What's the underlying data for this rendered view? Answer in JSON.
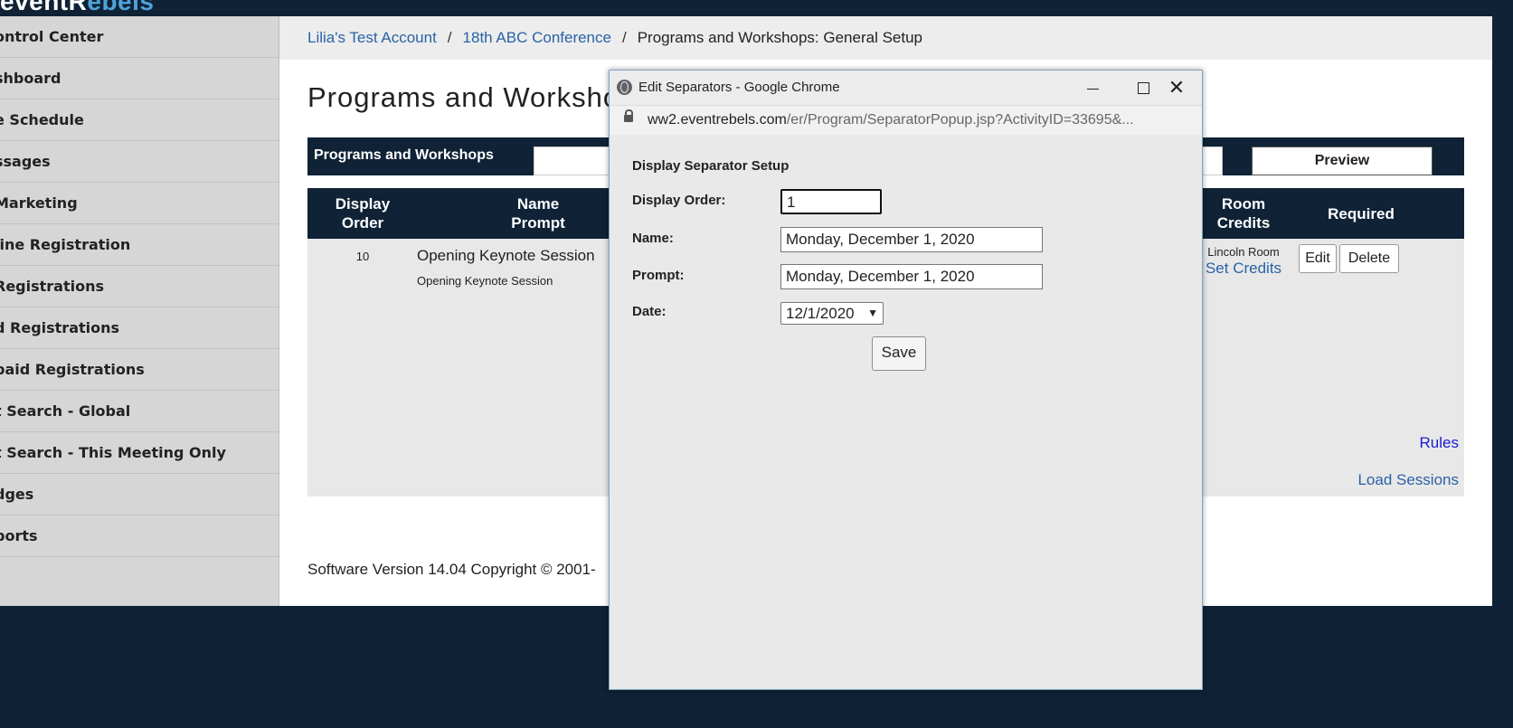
{
  "brand": {
    "logo_main": "eventR",
    "logo_accent": "ebels"
  },
  "sidebar": {
    "items": [
      {
        "label": "ontrol Center"
      },
      {
        "label": "shboard"
      },
      {
        "label": "e Schedule"
      },
      {
        "label": "ssages"
      },
      {
        "label": "Marketing"
      },
      {
        "label": "line Registration"
      },
      {
        "label": " Registrations"
      },
      {
        "label": "d Registrations"
      },
      {
        "label": "paid Registrations"
      },
      {
        "label": "t Search - Global"
      },
      {
        "label": "t Search - This Meeting Only"
      },
      {
        "label": "dges"
      },
      {
        "label": "ports"
      }
    ]
  },
  "breadcrumb": {
    "items": [
      {
        "label": "Lilia's Test Account"
      },
      {
        "label": "18th ABC Conference"
      }
    ],
    "separator": "/",
    "current": "Programs and Workshops: General Setup"
  },
  "main": {
    "title": "Programs and Worksho",
    "bar_label": "Programs and Workshops",
    "preview_label": "Preview",
    "table": {
      "headers": {
        "display": "Display",
        "order": "Order",
        "name": "Name",
        "prompt": "Prompt",
        "room": "Room",
        "credits": "Credits",
        "required": "Required"
      },
      "row": {
        "order": "10",
        "name": "Opening Keynote Session",
        "prompt": "Opening Keynote Session",
        "room": "Lincoln Room",
        "set_credits": "Set Credits",
        "edit": "Edit",
        "delete": "Delete"
      }
    },
    "rules_link": "Rules",
    "load_sessions_link": "Load Sessions",
    "footer": "Software Version 14.04   Copyright © 2001-"
  },
  "popup": {
    "title": "Edit Separators - Google Chrome",
    "url_domain": "ww2.eventrebels.com",
    "url_path": "/er/Program/SeparatorPopup.jsp?ActivityID=33695&...",
    "heading": "Display Separator Setup",
    "display_order_label": "Display Order:",
    "display_order_value": "1",
    "name_label": "Name:",
    "name_value": "Monday, December 1, 2020",
    "prompt_label": "Prompt:",
    "prompt_value": "Monday, December 1, 2020",
    "date_label": "Date:",
    "date_value": "12/1/2020",
    "save_label": "Save"
  },
  "colors": {
    "navy": "#0f2236",
    "link": "#2a62a6",
    "accent": "#4fa3d8"
  }
}
